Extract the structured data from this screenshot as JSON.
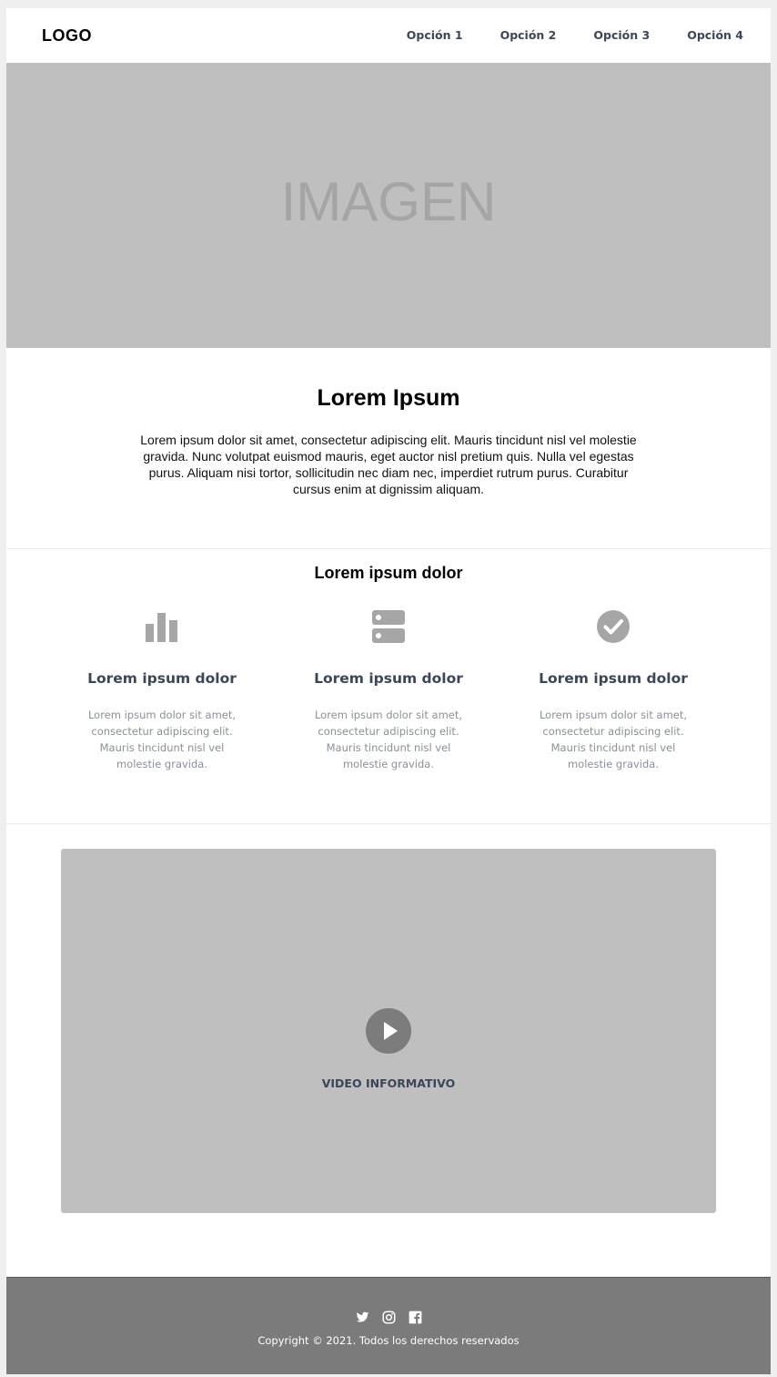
{
  "header": {
    "logo": "LOGO",
    "nav": [
      "Opción 1",
      "Opción 2",
      "Opción 3",
      "Opción 4"
    ]
  },
  "hero": {
    "placeholder": "IMAGEN"
  },
  "intro": {
    "title": "Lorem Ipsum",
    "body": "Lorem ipsum dolor sit amet, consectetur adipiscing elit. Mauris tincidunt nisl vel molestie gravida. Nunc volutpat euismod mauris, eget auctor nisl pretium quis. Nulla vel egestas purus. Aliquam nisi tortor, sollicitudin nec diam nec, imperdiet rutrum purus. Curabitur cursus enim at dignissim aliquam."
  },
  "features": {
    "title": "Lorem ipsum dolor",
    "items": [
      {
        "icon": "bar-chart-icon",
        "title": "Lorem ipsum dolor",
        "body": "Lorem ipsum dolor sit amet, consectetur adipiscing elit. Mauris tincidunt nisl vel molestie gravida."
      },
      {
        "icon": "server-icon",
        "title": "Lorem ipsum dolor",
        "body": "Lorem ipsum dolor sit amet, consectetur adipiscing elit. Mauris tincidunt nisl vel molestie gravida."
      },
      {
        "icon": "check-circle-icon",
        "title": "Lorem ipsum dolor",
        "body": "Lorem ipsum dolor sit amet, consectetur adipiscing elit. Mauris tincidunt nisl vel molestie gravida."
      }
    ]
  },
  "video": {
    "label": "VIDEO INFORMATIVO",
    "icon": "play-icon"
  },
  "footer": {
    "social": [
      "twitter-icon",
      "instagram-icon",
      "facebook-icon"
    ],
    "copyright": "Copyright © 2021. Todos los derechos reservados"
  },
  "colors": {
    "placeholder_bg": "#bfbfbf",
    "footer_bg": "#7b7b7b",
    "heading_text": "#3c4656",
    "muted_text": "#8a8f98",
    "icon_gray": "#a6a6a6"
  }
}
